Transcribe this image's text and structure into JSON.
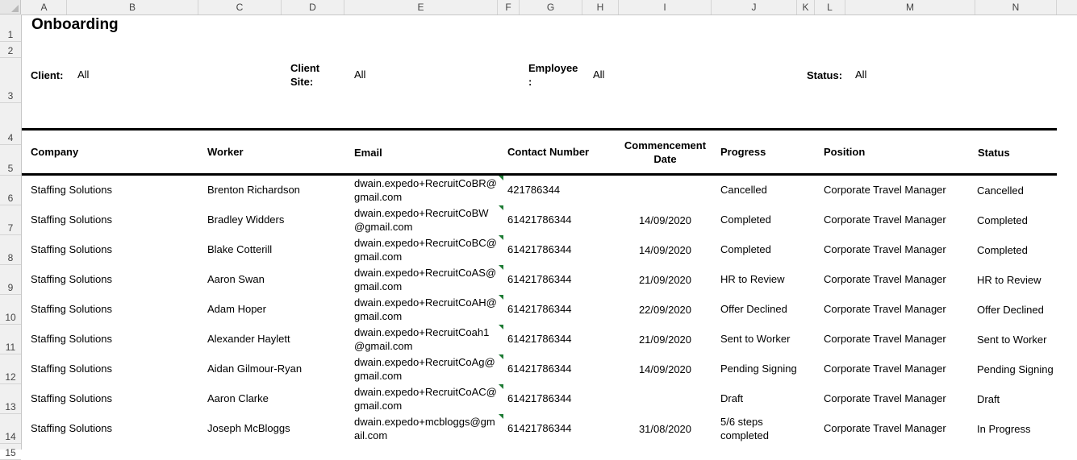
{
  "columns": [
    "A",
    "B",
    "C",
    "D",
    "E",
    "F",
    "G",
    "H",
    "I",
    "J",
    "K",
    "L",
    "M",
    "N"
  ],
  "rows": [
    "1",
    "2",
    "3",
    "4",
    "5",
    "6",
    "7",
    "8",
    "9",
    "10",
    "11",
    "12",
    "13",
    "14",
    "15"
  ],
  "title": "Onboarding",
  "filters": {
    "client_label": "Client:",
    "client_value": "All",
    "site_label_1": "Client",
    "site_label_2": "Site:",
    "site_value": "All",
    "employee_label_1": "Employee",
    "employee_label_2": ":",
    "employee_value": "All",
    "status_label": "Status:",
    "status_value": "All"
  },
  "table": {
    "headers": {
      "company": "Company",
      "worker": "Worker",
      "email": "Email",
      "contact": "Contact Number",
      "commencement_1": "Commencement",
      "commencement_2": "Date",
      "progress": "Progress",
      "position": "Position",
      "status": "Status"
    },
    "rows": [
      {
        "company": "Staffing Solutions",
        "worker": "Brenton Richardson",
        "email1": "dwain.expedo+RecruitCoBR@",
        "email2": "gmail.com",
        "contact": "421786344",
        "date": "",
        "progress1": "Cancelled",
        "progress2": "",
        "position": "Corporate Travel Manager",
        "status": "Cancelled"
      },
      {
        "company": "Staffing Solutions",
        "worker": "Bradley Widders",
        "email1": "dwain.expedo+RecruitCoBW",
        "email2": "@gmail.com",
        "contact": "61421786344",
        "date": "14/09/2020",
        "progress1": "Completed",
        "progress2": "",
        "position": "Corporate Travel Manager",
        "status": "Completed"
      },
      {
        "company": "Staffing Solutions",
        "worker": "Blake Cotterill",
        "email1": "dwain.expedo+RecruitCoBC@",
        "email2": "gmail.com",
        "contact": "61421786344",
        "date": "14/09/2020",
        "progress1": "Completed",
        "progress2": "",
        "position": "Corporate Travel Manager",
        "status": "Completed"
      },
      {
        "company": "Staffing Solutions",
        "worker": "Aaron Swan",
        "email1": "dwain.expedo+RecruitCoAS@",
        "email2": "gmail.com",
        "contact": "61421786344",
        "date": "21/09/2020",
        "progress1": "HR to Review",
        "progress2": "",
        "position": "Corporate Travel Manager",
        "status": "HR to Review"
      },
      {
        "company": "Staffing Solutions",
        "worker": "Adam Hoper",
        "email1": "dwain.expedo+RecruitCoAH@",
        "email2": "gmail.com",
        "contact": "61421786344",
        "date": "22/09/2020",
        "progress1": "Offer Declined",
        "progress2": "",
        "position": "Corporate Travel Manager",
        "status": "Offer Declined"
      },
      {
        "company": "Staffing Solutions",
        "worker": "Alexander Haylett",
        "email1": "dwain.expedo+RecruitCoah1",
        "email2": "@gmail.com",
        "contact": "61421786344",
        "date": "21/09/2020",
        "progress1": "Sent to Worker",
        "progress2": "",
        "position": "Corporate Travel Manager",
        "status": "Sent to Worker"
      },
      {
        "company": "Staffing Solutions",
        "worker": "Aidan Gilmour-Ryan",
        "email1": "dwain.expedo+RecruitCoAg@",
        "email2": "gmail.com",
        "contact": "61421786344",
        "date": "14/09/2020",
        "progress1": "Pending Signing",
        "progress2": "",
        "position": "Corporate Travel Manager",
        "status": "Pending Signing"
      },
      {
        "company": "Staffing Solutions",
        "worker": "Aaron Clarke",
        "email1": "dwain.expedo+RecruitCoAC@",
        "email2": "gmail.com",
        "contact": "61421786344",
        "date": "",
        "progress1": "Draft",
        "progress2": "",
        "position": "Corporate Travel Manager",
        "status": "Draft"
      },
      {
        "company": "Staffing Solutions",
        "worker": "Joseph McBloggs",
        "email1": "dwain.expedo+mcbloggs@gm",
        "email2": "ail.com",
        "contact": "61421786344",
        "date": "31/08/2020",
        "progress1": "5/6 steps",
        "progress2": "completed",
        "position": "Corporate Travel Manager",
        "status": "In Progress"
      }
    ]
  }
}
